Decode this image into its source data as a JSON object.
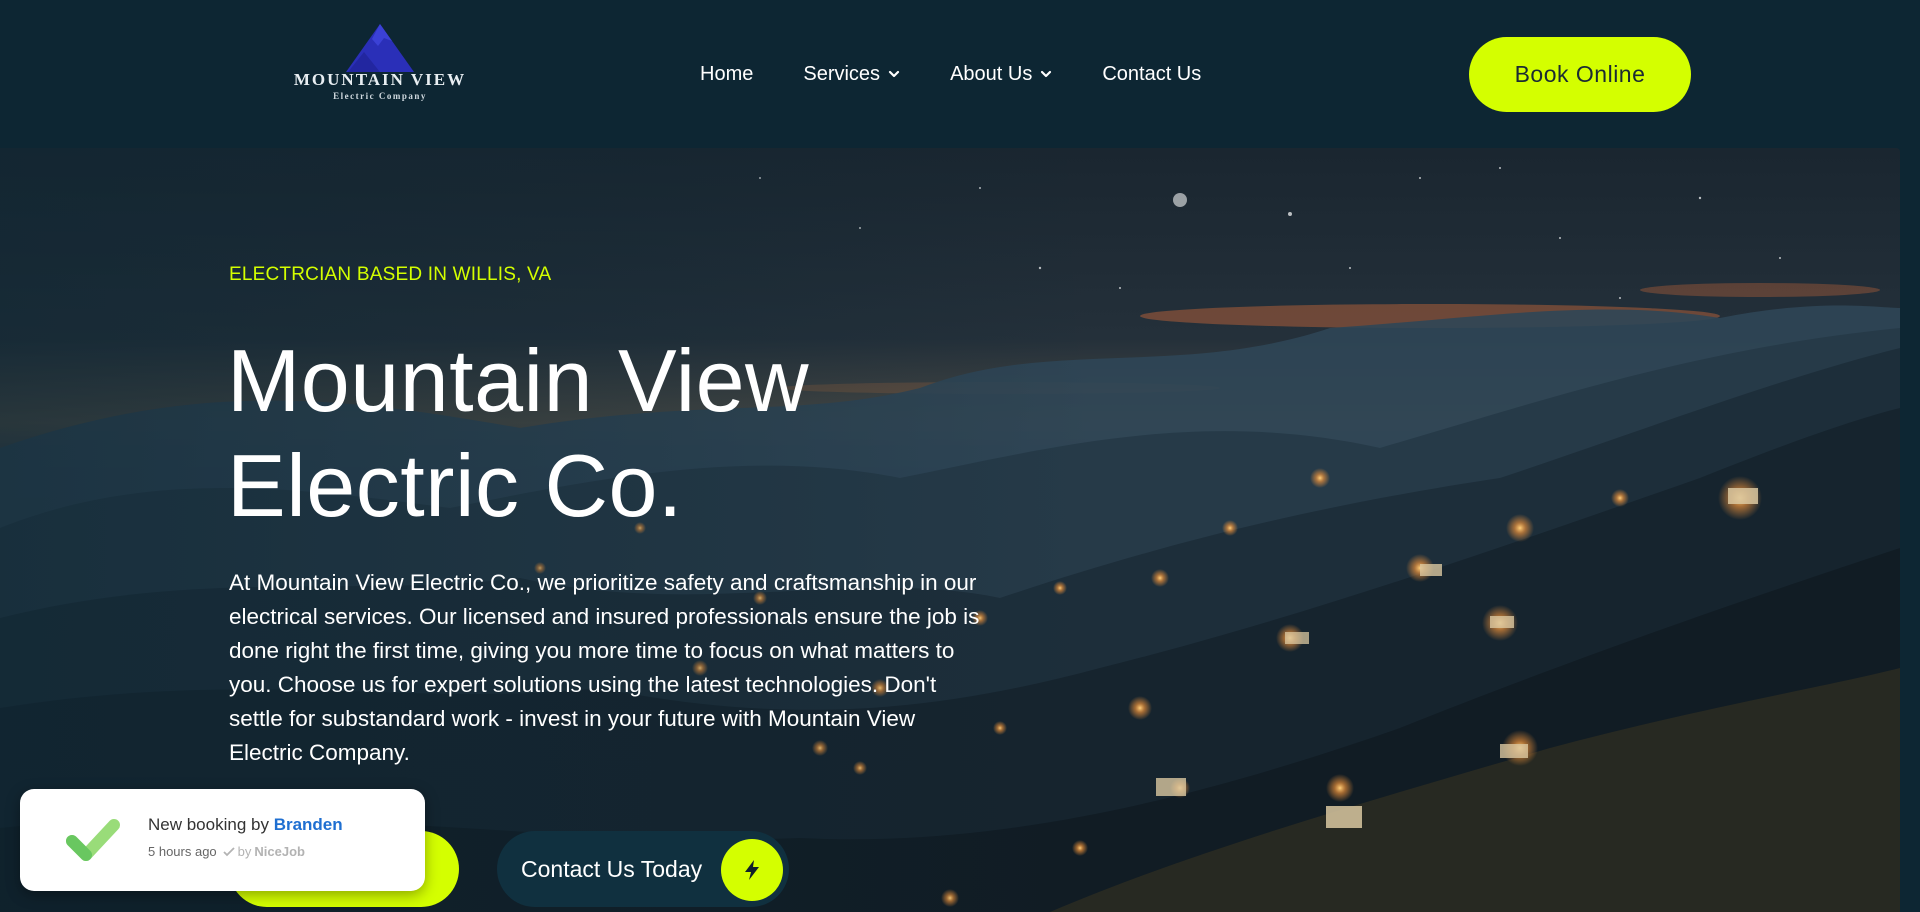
{
  "brand": {
    "name": "MOUNTAIN VIEW",
    "tagline": "Electric Company",
    "logo_color": "#2a2fb8"
  },
  "nav": {
    "items": [
      {
        "label": "Home",
        "has_dropdown": false
      },
      {
        "label": "Services",
        "has_dropdown": true
      },
      {
        "label": "About Us",
        "has_dropdown": true
      },
      {
        "label": "Contact Us",
        "has_dropdown": false
      }
    ],
    "book_button": "Book Online"
  },
  "hero": {
    "eyebrow": "ELECTRCIAN BASED IN WILLIS, VA",
    "title_line1": "Mountain View",
    "title_line2": "Electric Co.",
    "body": "At Mountain View Electric Co., we prioritize safety and craftsmanship in our electrical services. Our licensed and insured professionals ensure the job is done right the first time, giving you more time to focus on what matters to you. Choose us for expert solutions using the latest technologies. Don't settle for substandard work - invest in your future with Mountain View Electric Company.",
    "cta_secondary": "Contact Us Today"
  },
  "toast": {
    "prefix": "New booking by ",
    "customer": "Branden",
    "time": "5 hours ago",
    "by_prefix": "by ",
    "provider": "NiceJob"
  },
  "colors": {
    "background": "#0d2633",
    "accent": "#d4ff00",
    "link": "#1f6fd1"
  }
}
